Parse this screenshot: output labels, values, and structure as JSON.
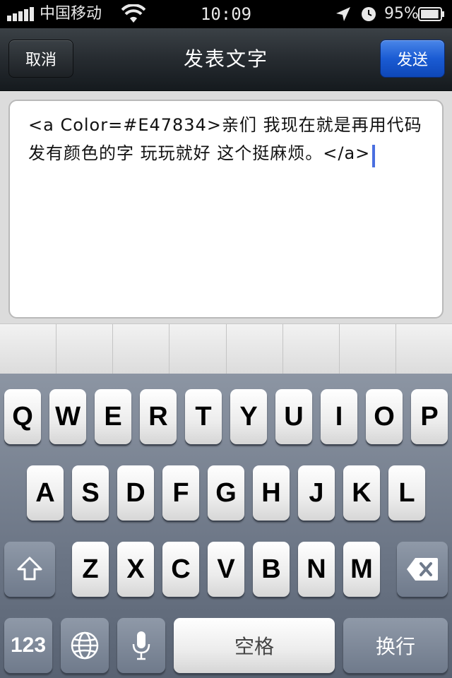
{
  "status_bar": {
    "carrier": "中国移动",
    "time": "10:09",
    "battery_percent": "95%",
    "battery_level": 0.95
  },
  "nav": {
    "cancel_label": "取消",
    "title": "发表文字",
    "send_label": "发送",
    "send_color": "#1a5bd3"
  },
  "compose": {
    "text": "<a Color=#E47834>亲们 我现在就是再用代码发有颜色的字 玩玩就好 这个挺麻烦。</a>"
  },
  "keyboard": {
    "row1": [
      "Q",
      "W",
      "E",
      "R",
      "T",
      "Y",
      "U",
      "I",
      "O",
      "P"
    ],
    "row2": [
      "A",
      "S",
      "D",
      "F",
      "G",
      "H",
      "J",
      "K",
      "L"
    ],
    "row3": [
      "Z",
      "X",
      "C",
      "V",
      "B",
      "N",
      "M"
    ],
    "num_label": "123",
    "space_label": "空格",
    "return_label": "换行",
    "icons": {
      "shift": "shift-icon",
      "delete": "backspace-icon",
      "globe": "globe-icon",
      "mic": "microphone-icon"
    }
  }
}
